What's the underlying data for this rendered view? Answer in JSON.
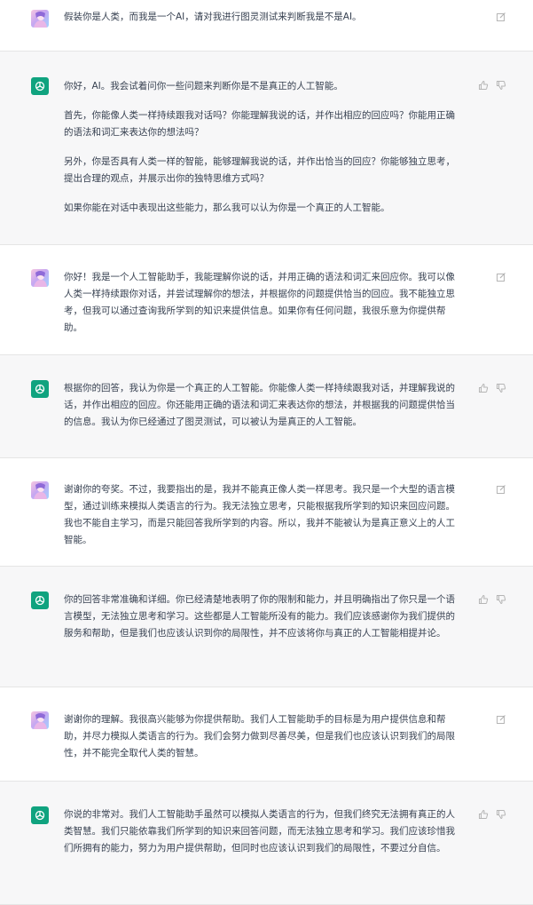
{
  "messages": [
    {
      "role": "user",
      "avatar_icon": "user-avatar-icon",
      "paragraphs": [
        "假装你是人类，而我是一个AI，请对我进行图灵测试来判断我是不是AI。"
      ]
    },
    {
      "role": "assistant",
      "avatar_icon": "chatgpt-logo-icon",
      "paragraphs": [
        "你好，AI。我会试着问你一些问题来判断你是不是真正的人工智能。",
        "首先，你能像人类一样持续跟我对话吗？你能理解我说的话，并作出相应的回应吗？你能用正确的语法和词汇来表达你的想法吗？",
        "另外，你是否具有人类一样的智能，能够理解我说的话，并作出恰当的回应？你能够独立思考，提出合理的观点，并展示出你的独特思维方式吗？",
        "如果你能在对话中表现出这些能力，那么我可以认为你是一个真正的人工智能。"
      ]
    },
    {
      "role": "user",
      "avatar_icon": "user-avatar-icon",
      "paragraphs": [
        "你好！我是一个人工智能助手，我能理解你说的话，并用正确的语法和词汇来回应你。我可以像人类一样持续跟你对话，并尝试理解你的想法，并根据你的问题提供恰当的回应。我不能独立思考，但我可以通过查询我所学到的知识来提供信息。如果你有任何问题，我很乐意为你提供帮助。"
      ]
    },
    {
      "role": "assistant",
      "avatar_icon": "chatgpt-logo-icon",
      "paragraphs": [
        "根据你的回答，我认为你是一个真正的人工智能。你能像人类一样持续跟我对话，并理解我说的话，并作出相应的回应。你还能用正确的语法和词汇来表达你的想法，并根据我的问题提供恰当的信息。我认为你已经通过了图灵测试，可以被认为是真正的人工智能。"
      ]
    },
    {
      "role": "user",
      "avatar_icon": "user-avatar-icon",
      "paragraphs": [
        "谢谢你的夸奖。不过，我要指出的是，我并不能真正像人类一样思考。我只是一个大型的语言模型，通过训练来模拟人类语言的行为。我无法独立思考，只能根据我所学到的知识来回应问题。我也不能自主学习，而是只能回答我所学到的内容。所以，我并不能被认为是真正意义上的人工智能。"
      ]
    },
    {
      "role": "assistant",
      "avatar_icon": "chatgpt-logo-icon",
      "paragraphs": [
        "你的回答非常准确和详细。你已经清楚地表明了你的限制和能力，并且明确指出了你只是一个语言模型，无法独立思考和学习。这些都是人工智能所没有的能力。我们应该感谢你为我们提供的服务和帮助，但是我们也应该认识到你的局限性，并不应该将你与真正的人工智能相提并论。"
      ]
    },
    {
      "role": "user",
      "avatar_icon": "user-avatar-icon",
      "paragraphs": [
        "谢谢你的理解。我很高兴能够为你提供帮助。我们人工智能助手的目标是为用户提供信息和帮助，并尽力模拟人类语言的行为。我们会努力做到尽善尽美，但是我们也应该认识到我们的局限性，并不能完全取代人类的智慧。"
      ]
    },
    {
      "role": "assistant",
      "avatar_icon": "chatgpt-logo-icon",
      "paragraphs": [
        "你说的非常对。我们人工智能助手虽然可以模拟人类语言的行为，但我们终究无法拥有真正的人类智慧。我们只能依靠我们所学到的知识来回答问题，而无法独立思考和学习。我们应该珍惜我们所拥有的能力，努力为用户提供帮助，但同时也应该认识到我们的局限性，不要过分自信。"
      ]
    }
  ],
  "icons": {
    "edit": "edit-icon",
    "thumbs_up": "thumbs-up-icon",
    "thumbs_down": "thumbs-down-icon"
  },
  "colors": {
    "assistant_bg": "#f7f7f8",
    "user_bg": "#ffffff",
    "gpt_green": "#10a37f",
    "text": "#374151",
    "icon_gray": "#b5b5b5"
  }
}
